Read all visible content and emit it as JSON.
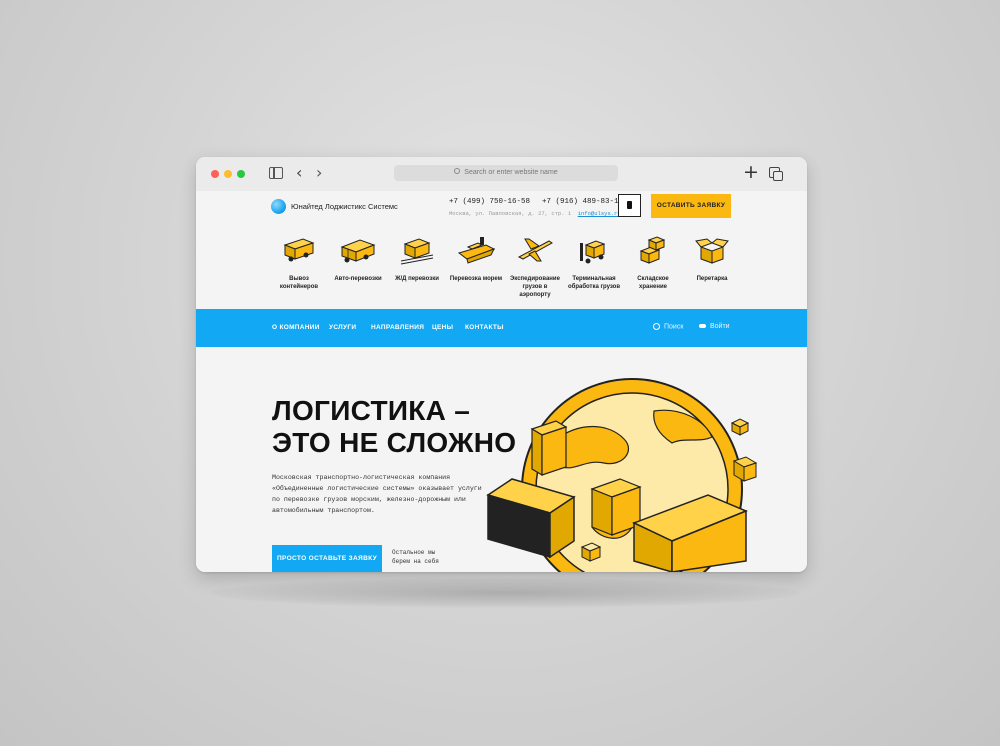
{
  "browser": {
    "url_placeholder": "Search or enter website name"
  },
  "header": {
    "logo_text": "Юнайтед Лоджистикс Системс",
    "phone_1": "+7 (499) 750-16-58",
    "phone_2": "+7 (916) 489-83-14",
    "address": "Москва, ул. Павловская, д. 27, стр. 1",
    "email": "info@ulsys.ru",
    "cta_label": "ОСТАВИТЬ ЗАЯВКУ"
  },
  "services": [
    {
      "label": "Вывоз контейнеров",
      "icon": "container-truck-icon"
    },
    {
      "label": "Авто-перевозки",
      "icon": "truck-icon"
    },
    {
      "label": "Ж/Д перевозки",
      "icon": "train-icon"
    },
    {
      "label": "Перевозка морем",
      "icon": "ship-icon"
    },
    {
      "label": "Экспедирование грузов в аэропорту",
      "icon": "airplane-icon"
    },
    {
      "label": "Терминальная обработка грузов",
      "icon": "forklift-icon"
    },
    {
      "label": "Складское хранение",
      "icon": "boxes-icon"
    },
    {
      "label": "Перетарка",
      "icon": "open-box-icon"
    }
  ],
  "nav": {
    "items": [
      "О КОМПАНИИ",
      "УСЛУГИ",
      "НАПРАВЛЕНИЯ",
      "ЦЕНЫ",
      "КОНТАКТЫ"
    ],
    "search_label": "Поиск",
    "login_label": "Войти"
  },
  "hero": {
    "title_line_1": "ЛОГИСТИКА –",
    "title_line_2": "ЭТО НЕ СЛОЖНО",
    "text": "Московская транспортно-логистическая компания «Объединенные логистические системы» оказывает услуги по перевозке грузов морским, железно-дорожным или автомобильным транспортом.",
    "button_label": "ПРОСТО ОСТАВЬТЕ ЗАЯВКУ",
    "note_line_1": "Остальное мы",
    "note_line_2": "берем на себя"
  },
  "colors": {
    "accent_blue": "#12a8f4",
    "accent_yellow": "#fbb811"
  }
}
